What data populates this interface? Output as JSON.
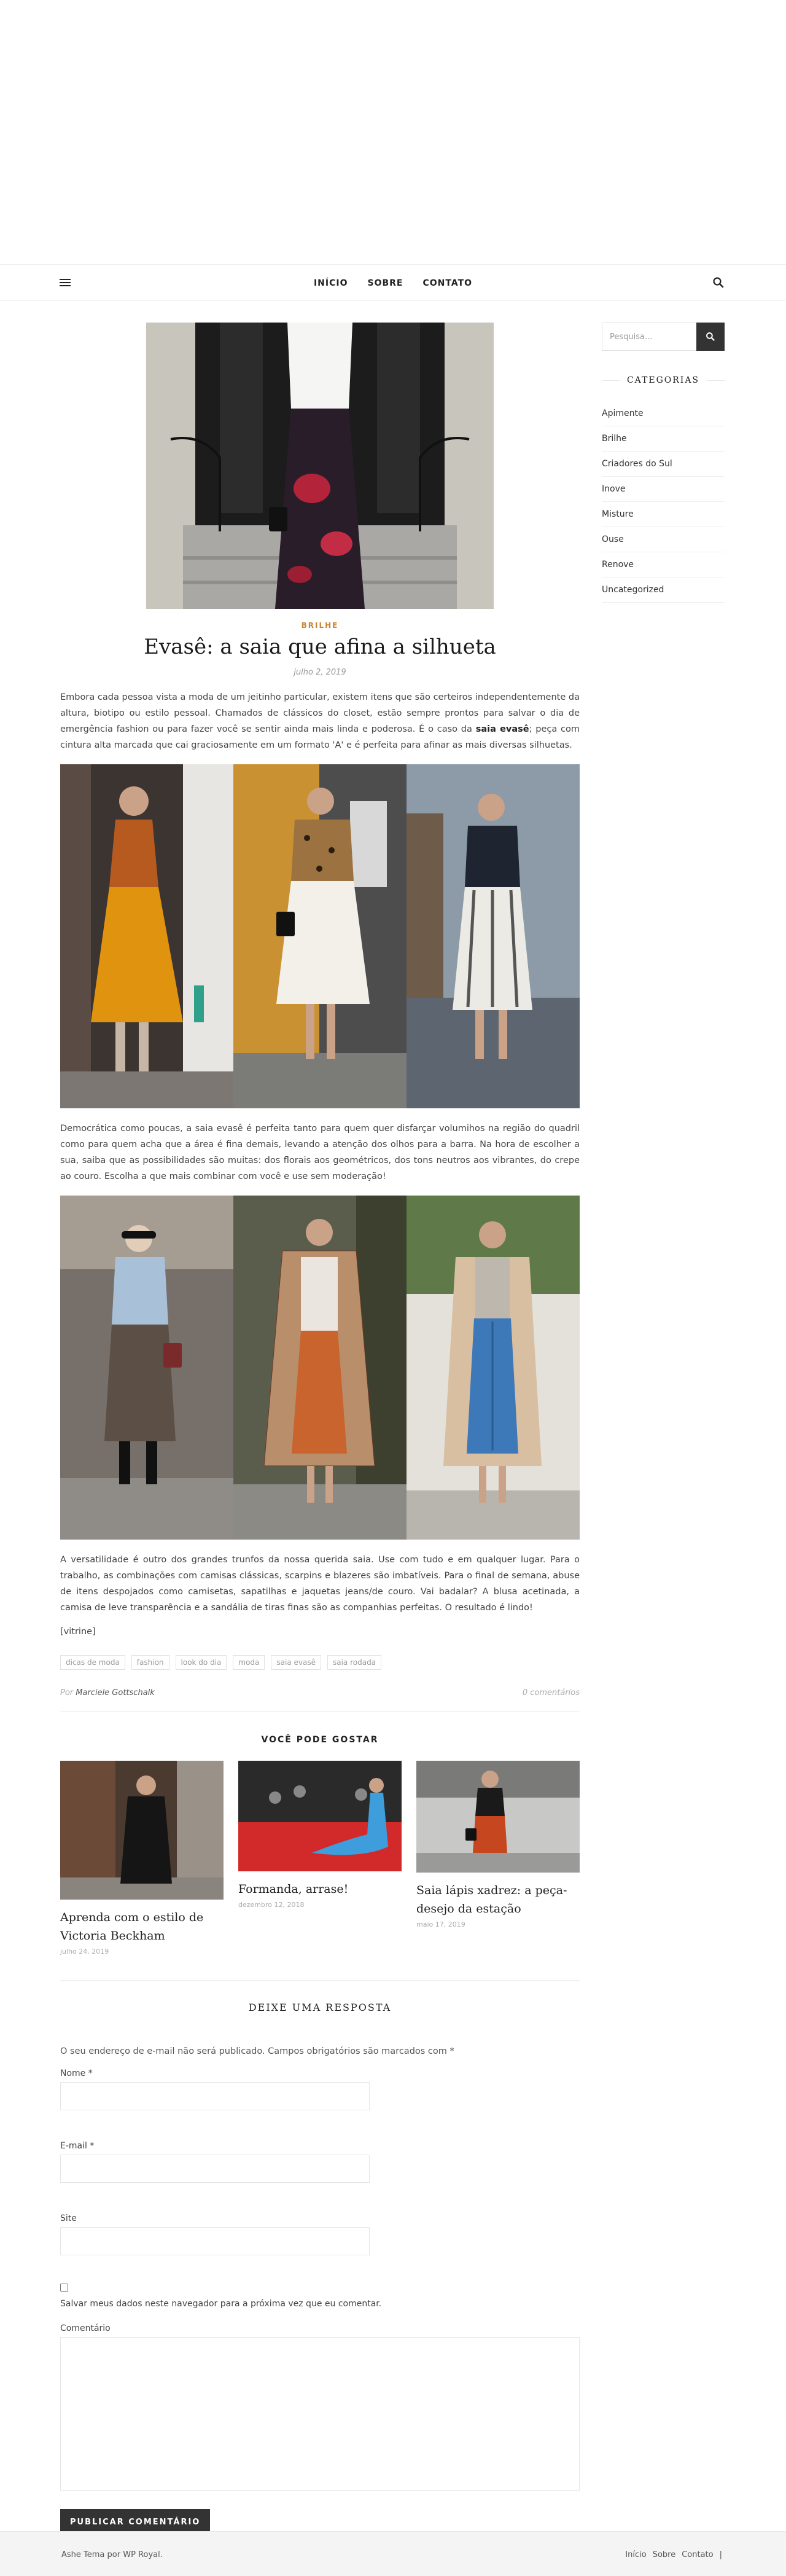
{
  "nav": {
    "items": [
      "INÍCIO",
      "SOBRE",
      "CONTATO"
    ]
  },
  "sidebar": {
    "search_placeholder": "Pesquisa...",
    "categories_title": "CATEGORIAS",
    "categories": [
      "Apimente",
      "Brilhe",
      "Criadores do Sul",
      "Inove",
      "Misture",
      "Ouse",
      "Renove",
      "Uncategorized"
    ]
  },
  "post": {
    "category": "BRILHE",
    "title": "Evasê: a saia que afina a silhueta",
    "date": "julho 2, 2019",
    "para1_a": "Embora cada pessoa vista a moda de um jeitinho particular, existem itens que são certeiros independentemente da altura, biotipo ou estilo pessoal. Chamados de clássicos do closet, estão sempre prontos para salvar o dia de emergência fashion ou para fazer você se sentir ainda mais linda e poderosa. É o caso da ",
    "para1_bold": "saia evasê",
    "para1_b": "; peça com cintura alta marcada que cai graciosamente em um formato 'A' e é perfeita para afinar as mais diversas silhuetas.",
    "para2": "Democrática como poucas, a saia evasê é perfeita tanto para quem quer disfarçar volumihos na região do quadril como para quem acha que a área é fina demais, levando a atenção dos olhos para a barra. Na hora de escolher a sua, saiba que as possibilidades são muitas: dos florais aos geométricos, dos tons neutros aos vibrantes, do crepe ao couro. Escolha a que mais combinar com você e use sem moderação!",
    "para3": "A versatilidade é outro dos grandes trunfos da nossa querida saia. Use com tudo e em qualquer lugar. Para o trabalho, as combinações com camisas clássicas, scarpins e blazeres são imbatíveis. Para o final de semana, abuse de itens despojados como camisetas, sapatilhas e jaquetas jeans/de couro. Vai badalar? A blusa acetinada, a camisa de leve transparência e a sandália de tiras finas são as companhias perfeitas. O resultado é lindo!",
    "vitrine": "[vitrine]",
    "tags": [
      "dicas de moda",
      "fashion",
      "look do dia",
      "moda",
      "saia evasê",
      "saia rodada"
    ],
    "author_prefix": "Por",
    "author": "Marciele Gottschalk",
    "comments": "0 comentários"
  },
  "related": {
    "heading": "VOCÊ PODE GOSTAR",
    "items": [
      {
        "title": "Aprenda com o estilo de Victoria Beckham",
        "date": "julho 24, 2019"
      },
      {
        "title": "Formanda, arrase!",
        "date": "dezembro 12, 2018"
      },
      {
        "title": "Saia lápis xadrez: a peça-desejo da estação",
        "date": "maio 17, 2019"
      }
    ]
  },
  "comment_form": {
    "heading": "DEIXE UMA RESPOSTA",
    "note": "O seu endereço de e-mail não será publicado. Campos obrigatórios são marcados com *",
    "name_label": "Nome *",
    "email_label": "E-mail *",
    "site_label": "Site",
    "save_label": "Salvar meus dados neste navegador para a próxima vez que eu comentar.",
    "comment_label": "Comentário",
    "submit": "PUBLICAR COMENTÁRIO"
  },
  "footer": {
    "credit": "Ashe Tema por WP Royal.",
    "links": [
      "Início",
      "Sobre",
      "Contato"
    ],
    "separator": "|"
  },
  "colors": {
    "accent": "#c9852e",
    "dark": "#333333",
    "footer_bg": "#f4f4f4"
  }
}
